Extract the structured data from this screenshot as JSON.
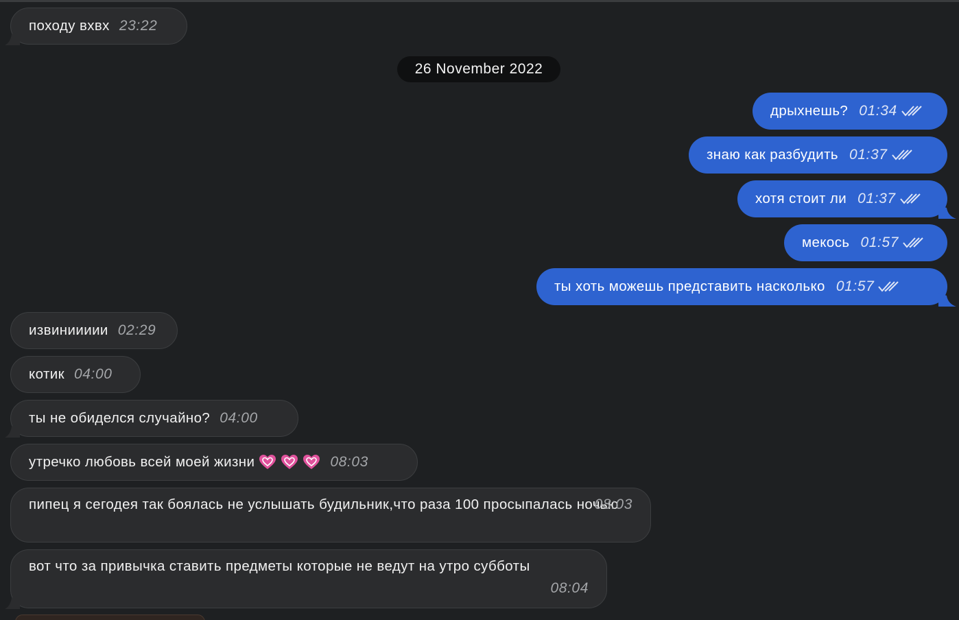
{
  "chat": {
    "date_separator": "26 November 2022",
    "messages": [
      {
        "id": "m1",
        "direction": "incoming",
        "text": "походу вхвх",
        "time": "23:22"
      },
      {
        "id": "m2",
        "direction": "outgoing",
        "text": "дрыхнешь?",
        "time": "01:34",
        "status": "read"
      },
      {
        "id": "m3",
        "direction": "outgoing",
        "text": "знаю как разбудить",
        "time": "01:37",
        "status": "read"
      },
      {
        "id": "m4",
        "direction": "outgoing",
        "text": "хотя стоит ли",
        "time": "01:37",
        "status": "read"
      },
      {
        "id": "m5",
        "direction": "outgoing",
        "text": "мекось",
        "time": "01:57",
        "status": "read"
      },
      {
        "id": "m6",
        "direction": "outgoing",
        "text": "ты хоть можешь представить насколько",
        "time": "01:57",
        "status": "read"
      },
      {
        "id": "m7",
        "direction": "incoming",
        "text": "извиниииии",
        "time": "02:29"
      },
      {
        "id": "m8",
        "direction": "incoming",
        "text": "котик",
        "time": "04:00"
      },
      {
        "id": "m9",
        "direction": "incoming",
        "text": "ты не обиделся случайно?",
        "time": "04:00"
      },
      {
        "id": "m10",
        "direction": "incoming",
        "text": "утречко любовь всей моей жизни",
        "emoji": [
          "heart",
          "heart",
          "heart"
        ],
        "time": "08:03"
      },
      {
        "id": "m11",
        "direction": "incoming",
        "text": "пипец я сегодея так боялась не услышать будильник,что раза 100 просыпалась ночью",
        "time": "08:03"
      },
      {
        "id": "m12",
        "direction": "incoming",
        "text": "вот что за привычка ставить предметы которые не ведут на утро субботы",
        "time": "08:04"
      }
    ]
  },
  "colors": {
    "background": "#1e2022",
    "incoming_bubble": "#2b2c2e",
    "outgoing_bubble": "#2e63d0",
    "date_pill": "#0f1011",
    "heart_emoji": "#e0529c"
  },
  "icons": {
    "read_status": "double-check-icon",
    "emoji": "growing-heart-emoji"
  }
}
